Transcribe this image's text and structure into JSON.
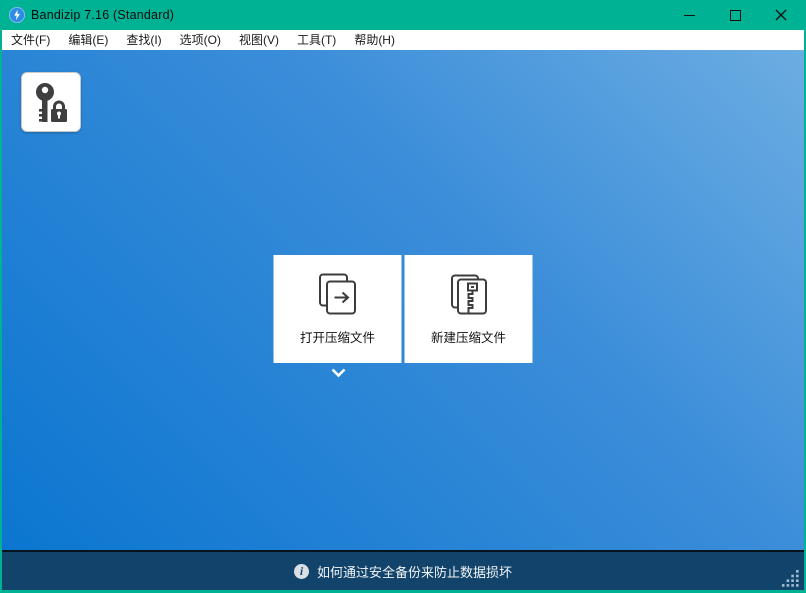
{
  "titlebar": {
    "title": "Bandizip 7.16 (Standard)",
    "controls": {
      "minimize_icon": "minimize-icon",
      "maximize_icon": "maximize-icon",
      "close_icon": "close-icon"
    }
  },
  "menu": {
    "items": [
      "文件(F)",
      "编辑(E)",
      "查找(I)",
      "选项(O)",
      "视图(V)",
      "工具(T)",
      "帮助(H)"
    ]
  },
  "toolbar": {
    "password_manager_icon": "key-lock-icon"
  },
  "main": {
    "open_archive_label": "打开压缩文件",
    "new_archive_label": "新建压缩文件",
    "expand_chevron_icon": "chevron-down-icon"
  },
  "statusbar": {
    "tip": "如何通过安全备份来防止数据损坏",
    "info_icon": "info-icon",
    "resize_grip_icon": "resize-grip-icon"
  },
  "colors": {
    "accent_teal": "#00b294",
    "background_gradient_top_right": "#6cade2",
    "background_gradient_bottom_left": "#0b76d0",
    "statusbar_background": "#12436a",
    "menubar_background": "#ffffff",
    "title_text": "#0c0c0c"
  }
}
